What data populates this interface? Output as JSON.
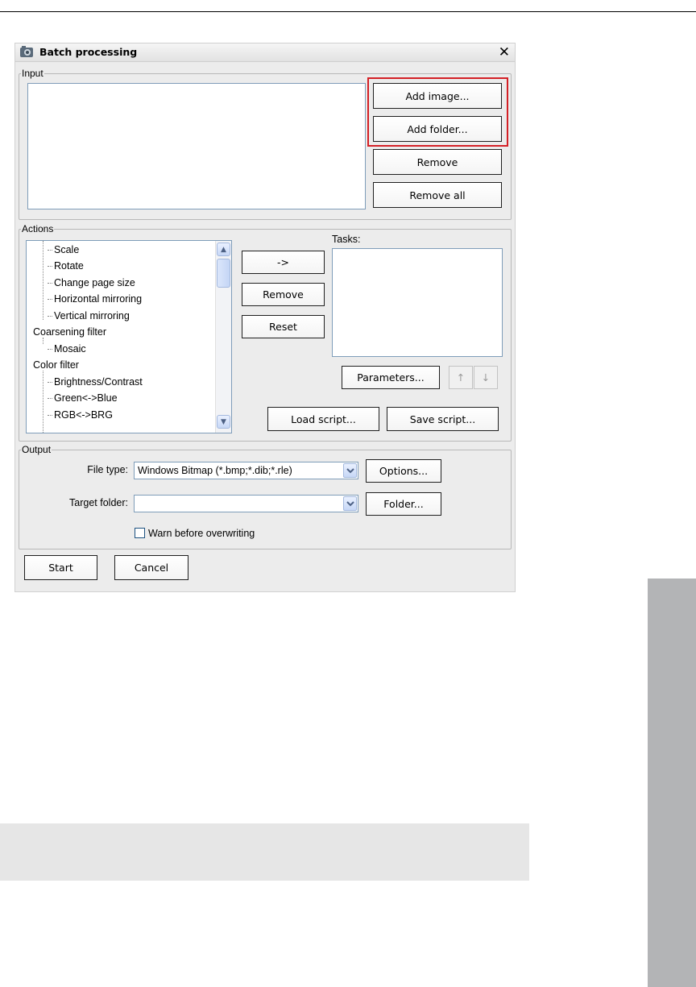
{
  "dialog": {
    "title": "Batch processing",
    "close": "✕"
  },
  "input": {
    "legend": "Input",
    "add_image": "Add image...",
    "add_folder": "Add folder...",
    "remove": "Remove",
    "remove_all": "Remove all"
  },
  "actions": {
    "legend": "Actions",
    "tree": [
      "Scale",
      "Rotate",
      "Change page size",
      "Horizontal mirroring",
      "Vertical mirroring",
      "Coarsening filter",
      "Mosaic",
      "Color filter",
      "Brightness/Contrast",
      "Green<->Blue",
      "RGB<->BRG"
    ],
    "arrow_button": "->",
    "remove": "Remove",
    "reset": "Reset",
    "tasks_label": "Tasks:",
    "parameters": "Parameters...",
    "up_arrow": "↑",
    "down_arrow": "↓",
    "load_script": "Load script...",
    "save_script": "Save script..."
  },
  "output": {
    "legend": "Output",
    "file_type_label": "File type:",
    "file_type_value": "Windows Bitmap (*.bmp;*.dib;*.rle)",
    "options": "Options...",
    "target_folder_label": "Target folder:",
    "target_folder_value": "",
    "folder": "Folder...",
    "warn_label": "Warn before overwriting",
    "warn_checked": false
  },
  "footer": {
    "start": "Start",
    "cancel": "Cancel"
  },
  "colors": {
    "highlight": "#d42026",
    "side_tab": "#b3b4b6",
    "dialog_bg": "#ececec"
  }
}
